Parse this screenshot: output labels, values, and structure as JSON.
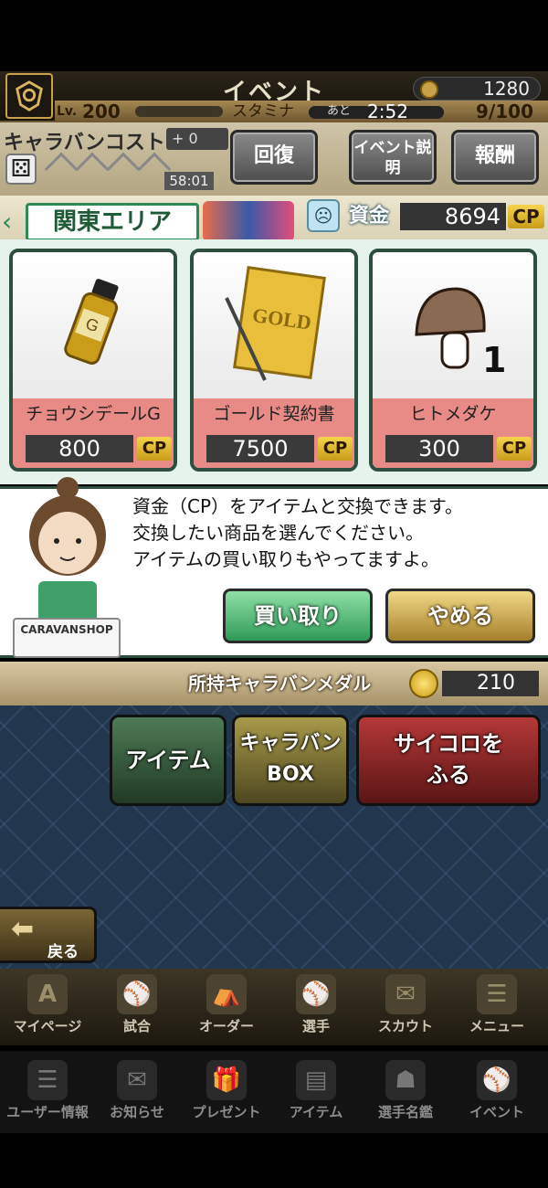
{
  "header": {
    "title": "イベント",
    "coins": "1280",
    "level_label": "Lv.",
    "level": "200",
    "stamina_label": "スタミナ",
    "remaining_label": "あと",
    "timer": "2:52",
    "stamina_value": "9/100"
  },
  "caravan": {
    "cost_title": "キャラバンコスト",
    "cost_plus": "+ 0",
    "cost_timer": "58:01",
    "buttons": {
      "recover": "回復",
      "event_info": "イベント説明",
      "reward": "報酬"
    }
  },
  "area": {
    "name": "関東エリア",
    "fund_label": "資金",
    "fund_value": "8694",
    "cp_unit": "CP"
  },
  "shop": {
    "items": [
      {
        "name": "チョウシデールG",
        "price": "800",
        "icon": "tonic-bottle-icon"
      },
      {
        "name": "ゴールド契約書",
        "price": "7500",
        "icon": "gold-contract-icon"
      },
      {
        "name": "ヒトメダケ",
        "price": "300",
        "icon": "mushroom-icon",
        "count": "1"
      }
    ]
  },
  "dialog": {
    "line1": "資金（CP）をアイテムと交換できます。",
    "line2": "交換したい商品を選んでください。",
    "line3": "アイテムの買い取りもやってますよ。",
    "buy_label": "買い取り",
    "quit_label": "やめる",
    "counter_label": "CARAVANSHOP"
  },
  "medal": {
    "label": "所持キャラバンメダル",
    "value": "210"
  },
  "map_buttons": {
    "item": "アイテム",
    "box_line1": "キャラバン",
    "box_line2": "BOX",
    "dice_line1": "サイコロを",
    "dice_line2": "ふる",
    "back": "戻る"
  },
  "nav_main": [
    {
      "label": "マイページ",
      "icon": "A"
    },
    {
      "label": "試合",
      "icon": "⚾"
    },
    {
      "label": "オーダー",
      "icon": "⛺"
    },
    {
      "label": "選手",
      "icon": "⚾"
    },
    {
      "label": "スカウト",
      "icon": "✉"
    },
    {
      "label": "メニュー",
      "icon": "☰"
    }
  ],
  "nav_sub": [
    {
      "label": "ユーザー情報",
      "icon": "☰"
    },
    {
      "label": "お知らせ",
      "icon": "✉"
    },
    {
      "label": "プレゼント",
      "icon": "🎁"
    },
    {
      "label": "アイテム",
      "icon": "▤"
    },
    {
      "label": "選手名鑑",
      "icon": "☗"
    },
    {
      "label": "イベント",
      "icon": "⚾"
    }
  ],
  "colors": {
    "accent_green": "#2d8a55",
    "card_pink": "#e88a86",
    "gold": "#c99d1a"
  }
}
